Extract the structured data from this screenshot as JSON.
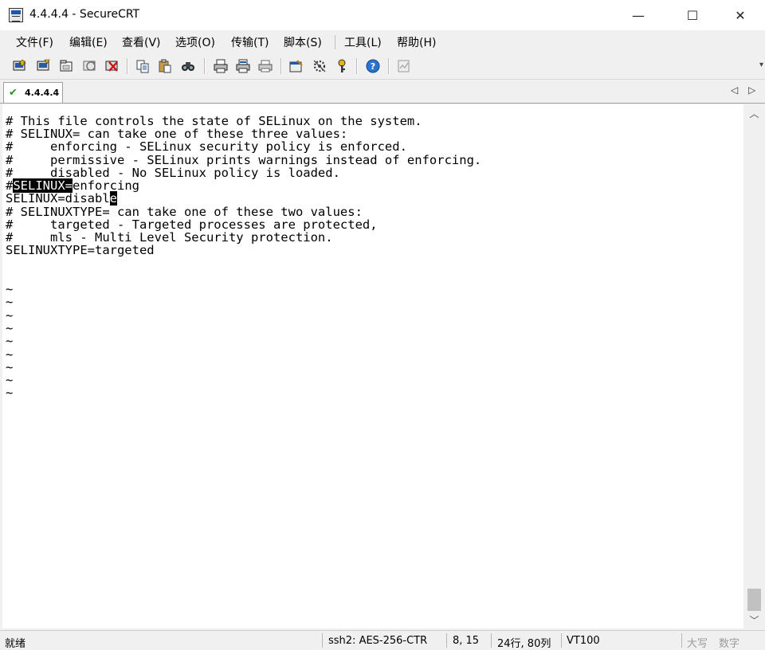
{
  "window": {
    "title": "4.4.4.4 - SecureCRT",
    "min_glyph": "—",
    "max_glyph": "☐",
    "close_glyph": "✕"
  },
  "menu": [
    "文件(F)",
    "编辑(E)",
    "查看(V)",
    "选项(O)",
    "传输(T)",
    "脚本(S)",
    "工具(L)",
    "帮助(H)"
  ],
  "toolbar": {
    "icons": [
      "connect-icon",
      "quick-connect-icon",
      "connect-in-tab-icon",
      "reconnect-icon",
      "disconnect-icon",
      "copy-icon",
      "paste-icon",
      "find-icon",
      "print-icon",
      "print-selection-icon",
      "print-setup-icon",
      "session-options-icon",
      "global-options-icon",
      "keymap-icon",
      "help-icon",
      "log-session-icon"
    ]
  },
  "tab": {
    "label": "4.4.4.4",
    "check_glyph": "✔",
    "nav_left": "◁",
    "nav_right": "▷"
  },
  "terminal": {
    "lines": [
      "# This file controls the state of SELinux on the system.",
      "# SELINUX= can take one of these three values:",
      "#     enforcing - SELinux security policy is enforced.",
      "#     permissive - SELinux prints warnings instead of enforcing.",
      "#     disabled - No SELinux policy is loaded."
    ],
    "line6_prefix": "#",
    "line6_selection": "SELINUX=",
    "line6_rest": "enforcing",
    "line7_text": "SELINUX=disabl",
    "line7_cursor": "e",
    "lines2": [
      "# SELINUXTYPE= can take one of these two values:",
      "#     targeted - Targeted processes are protected,",
      "#     mls - Multi Level Security protection.",
      "SELINUXTYPE=targeted"
    ],
    "tilde": "~",
    "tilde_count": 9
  },
  "scrollbar": {
    "up": "︿",
    "down": "﹀"
  },
  "status": {
    "ready": "就绪",
    "cipher": "ssh2: AES-256-CTR",
    "cursor_pos": "8, 15",
    "size": "24行, 80列",
    "emulation": "VT100",
    "caps": "大写",
    "num": "数字"
  }
}
